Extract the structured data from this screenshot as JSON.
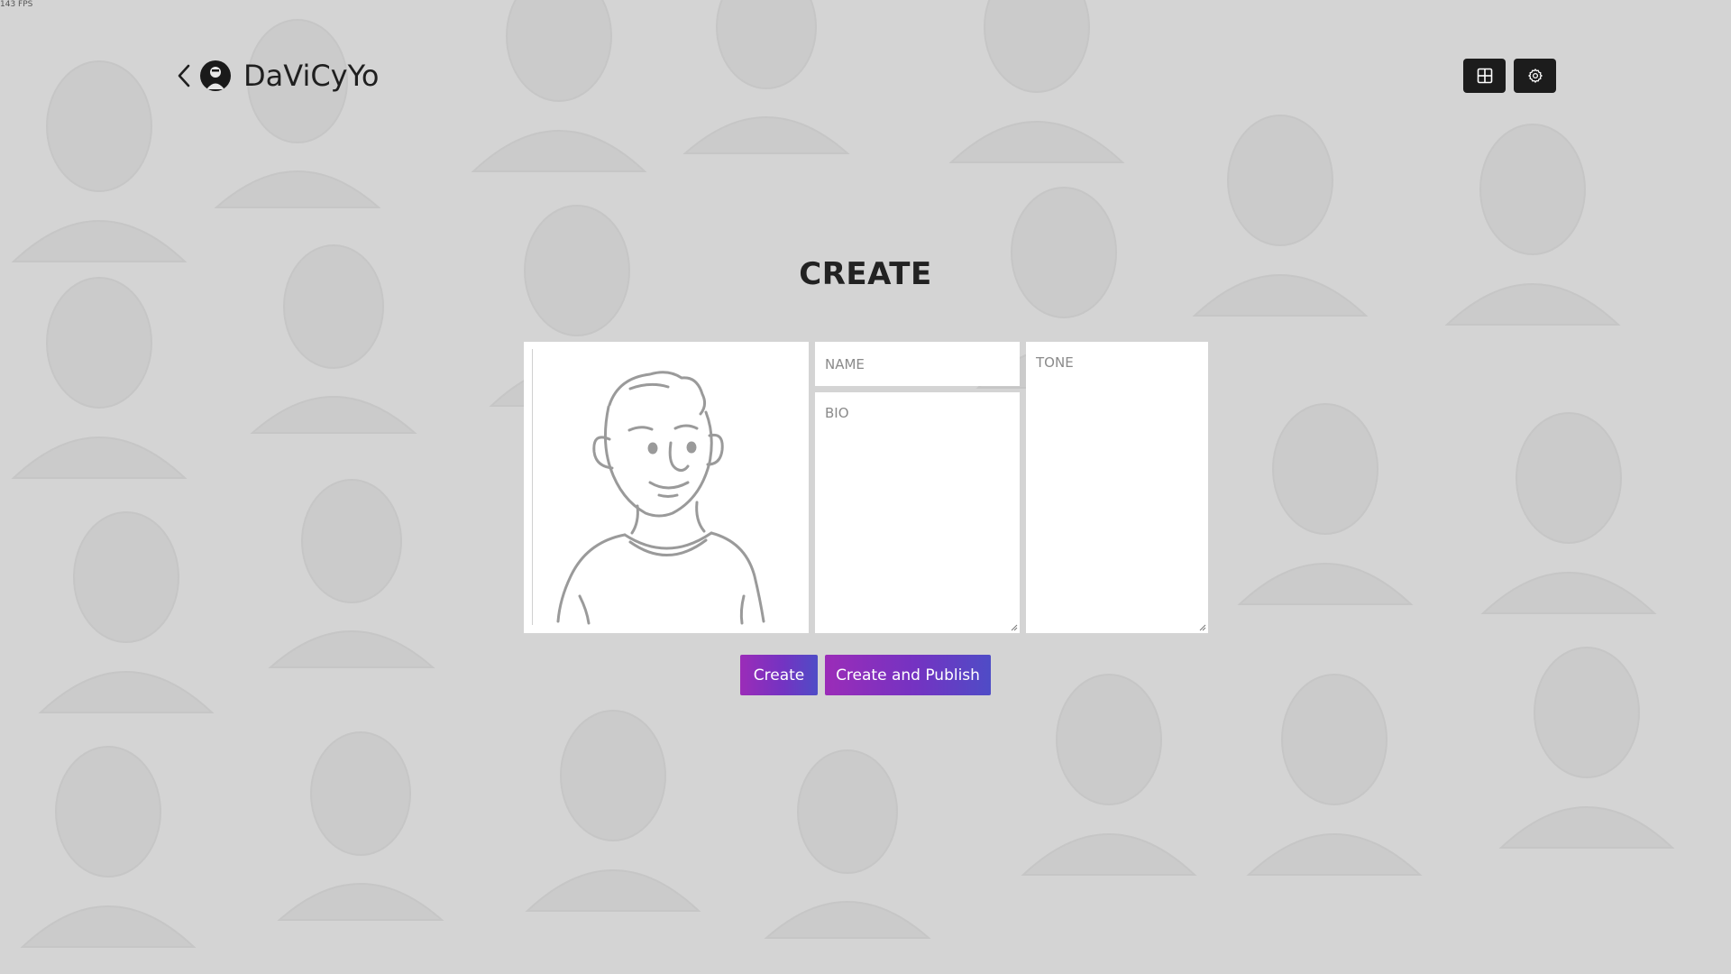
{
  "fps_label": "143 FPS",
  "header": {
    "brand": "DaViCyYo"
  },
  "page": {
    "title": "CREATE"
  },
  "form": {
    "name_placeholder": "NAME",
    "bio_placeholder": "BIO",
    "tone_placeholder": "TONE",
    "name_value": "",
    "bio_value": "",
    "tone_value": ""
  },
  "actions": {
    "create_label": "Create",
    "publish_label": "Create and Publish"
  },
  "colors": {
    "background": "#d4d4d4",
    "header_button": "#1c1c1c",
    "button_gradient_start": "#9b2cb8",
    "button_gradient_end": "#4f4cc6"
  },
  "icons": {
    "back": "chevron-left-icon",
    "layout": "grid-icon",
    "settings": "gear-icon",
    "avatar_placeholder": "person-sketch-icon"
  }
}
